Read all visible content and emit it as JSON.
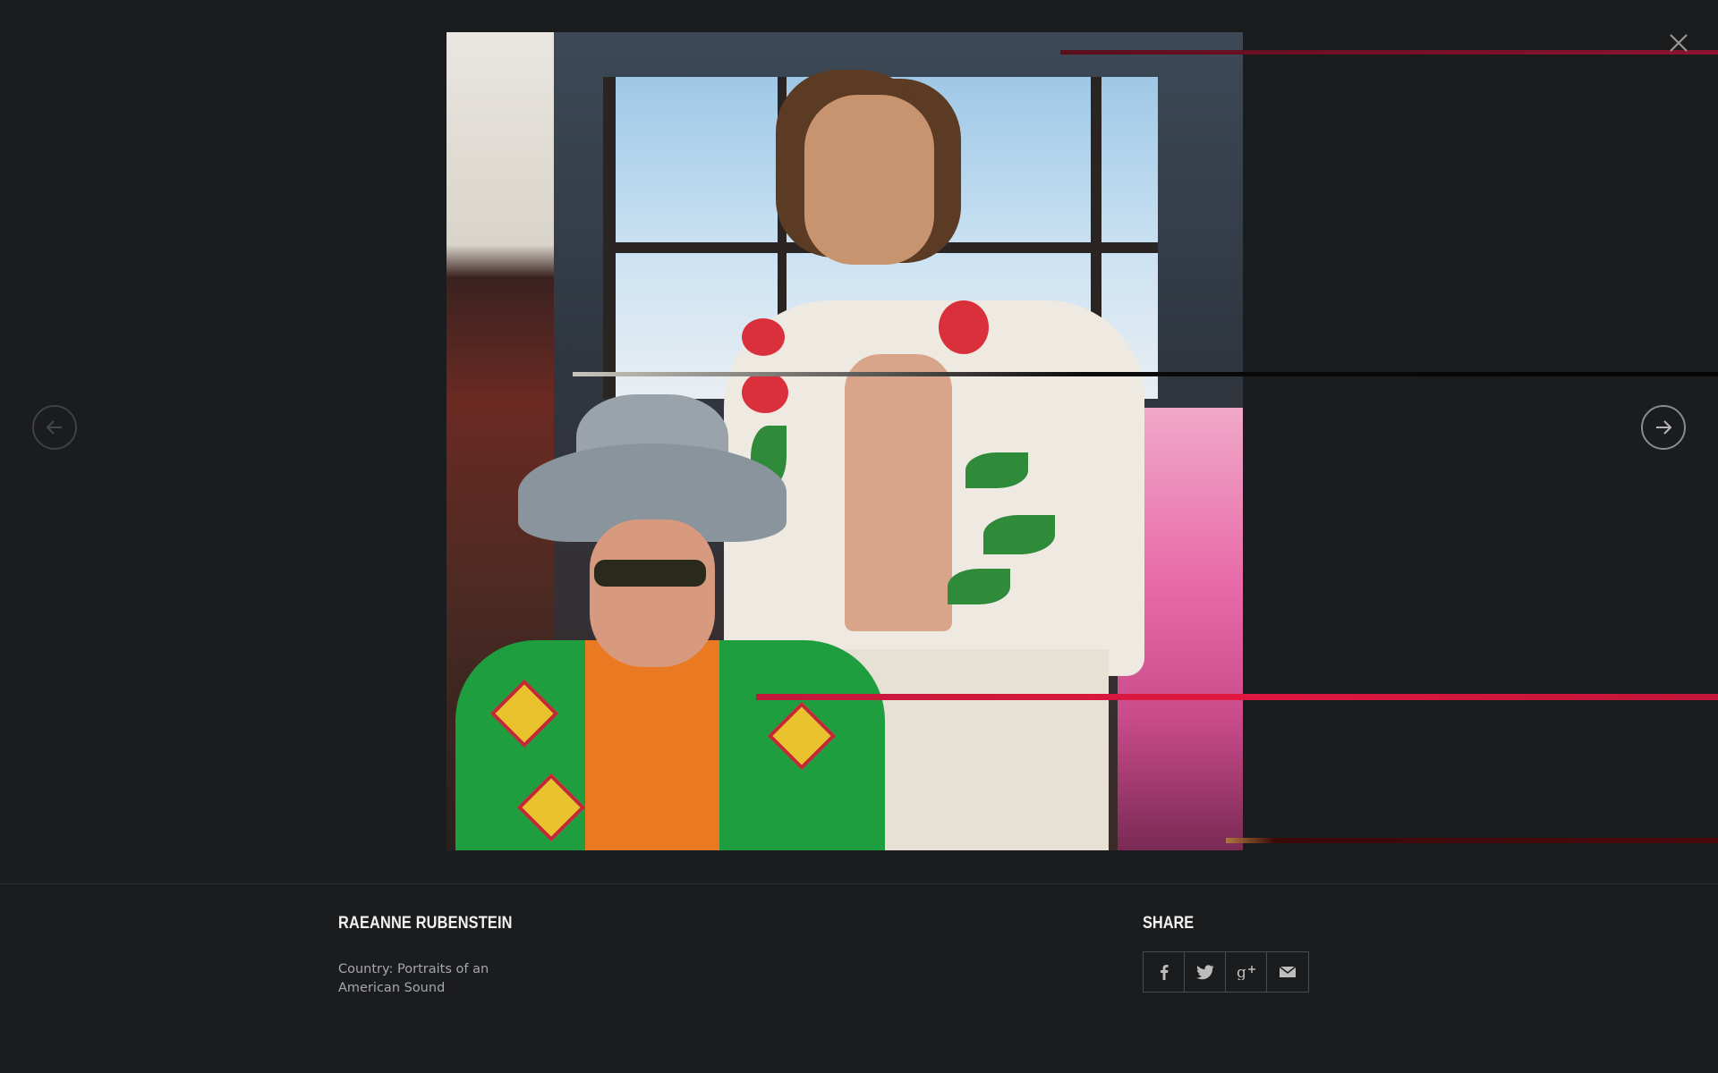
{
  "gallery": {
    "photo_alt": "",
    "close_icon": "close-icon",
    "prev_icon": "arrow-left-icon",
    "next_icon": "arrow-right-icon"
  },
  "caption": {
    "author": "RAEANNE RUBENSTEIN",
    "title": "Country: Portraits of an American Sound"
  },
  "share": {
    "title": "SHARE",
    "buttons": [
      {
        "icon": "facebook-icon",
        "glyph": "f"
      },
      {
        "icon": "twitter-icon",
        "glyph": "t"
      },
      {
        "icon": "google-plus-icon",
        "glyph": "g+"
      },
      {
        "icon": "email-icon",
        "glyph": "✉"
      }
    ]
  },
  "colors": {
    "background": "#1b1c1e",
    "text_primary": "#f2f2f2",
    "text_secondary": "#a6a7a9",
    "border": "#4a4b4d"
  }
}
